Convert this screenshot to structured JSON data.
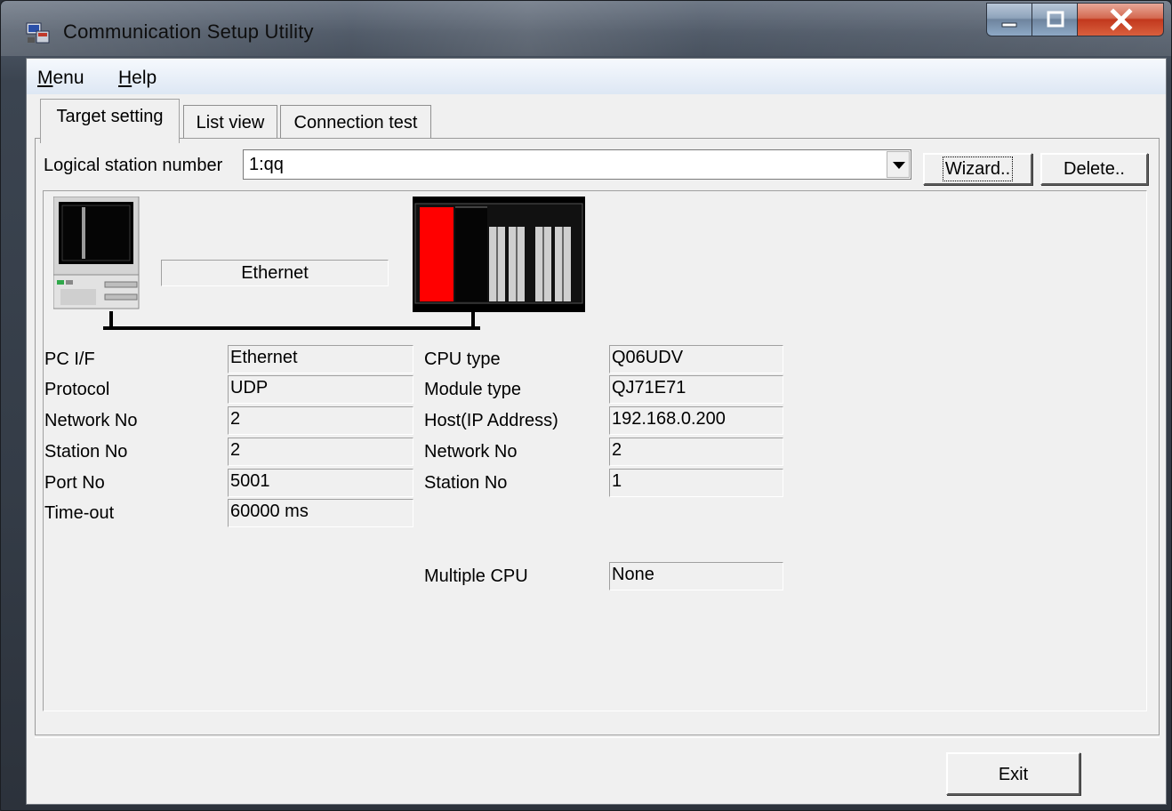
{
  "window": {
    "title": "Communication Setup Utility"
  },
  "menu": {
    "items": [
      {
        "label": "Menu"
      },
      {
        "label": "Help"
      }
    ]
  },
  "tabs": [
    {
      "label": "Target setting",
      "active": true
    },
    {
      "label": "List view",
      "active": false
    },
    {
      "label": "Connection test",
      "active": false
    }
  ],
  "target": {
    "logical_station_label": "Logical station number",
    "logical_station_value": "1:qq",
    "wizard_label": "Wizard..",
    "delete_label": "Delete.."
  },
  "diagram": {
    "connection_label": "Ethernet"
  },
  "pc_side": {
    "rows": [
      {
        "label": "PC I/F",
        "value": "Ethernet"
      },
      {
        "label": "Protocol",
        "value": "UDP"
      },
      {
        "label": "Network No",
        "value": "2"
      },
      {
        "label": "Station No",
        "value": "2"
      },
      {
        "label": "Port No",
        "value": "5001"
      },
      {
        "label": "Time-out",
        "value": "60000 ms"
      }
    ]
  },
  "plc_side": {
    "rows": [
      {
        "label": "CPU type",
        "value": "Q06UDV"
      },
      {
        "label": "Module type",
        "value": "QJ71E71"
      },
      {
        "label": "Host(IP Address)",
        "value": "192.168.0.200"
      },
      {
        "label": "Network No",
        "value": "2"
      },
      {
        "label": "Station No",
        "value": "1"
      }
    ],
    "multiple_cpu_label": "Multiple CPU",
    "multiple_cpu_value": "None"
  },
  "footer": {
    "exit_label": "Exit"
  },
  "icons": {
    "app": "network-computer-icon",
    "minimize": "minimize-icon",
    "maximize": "maximize-icon",
    "close": "close-icon",
    "pc": "personal-computer-icon",
    "plc": "plc-rack-icon"
  }
}
